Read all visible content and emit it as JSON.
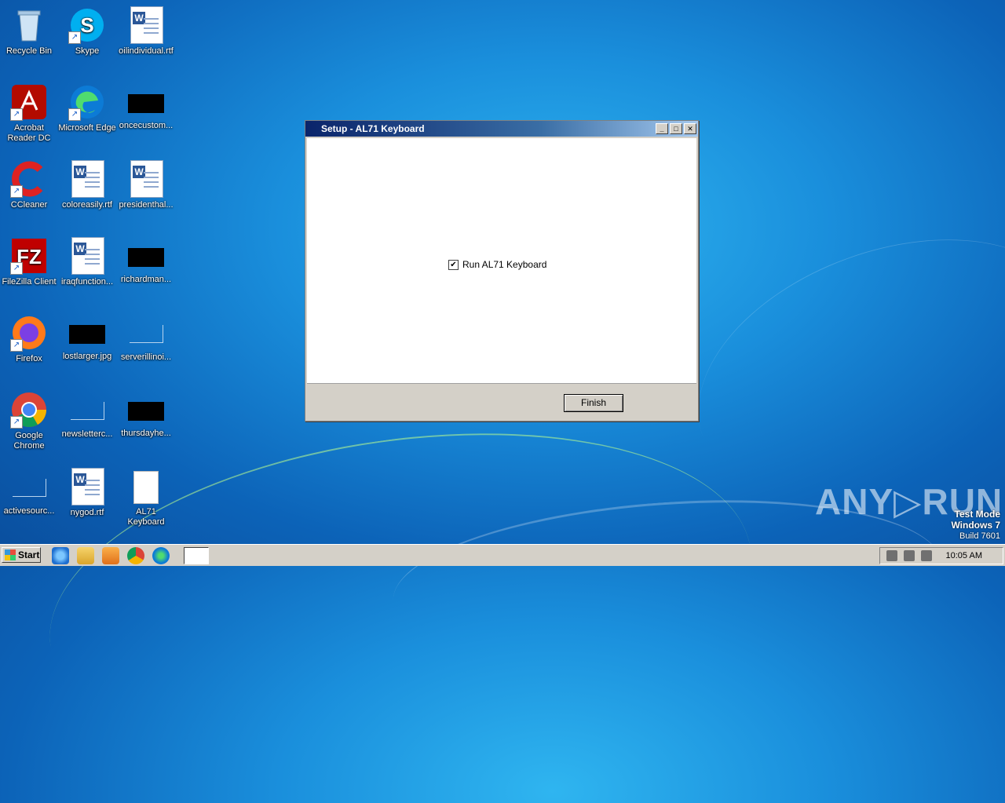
{
  "desktop_icons": [
    {
      "label": "Recycle Bin"
    },
    {
      "label": "Skype"
    },
    {
      "label": "oilindividual.rtf"
    },
    {
      "label": "Acrobat Reader DC"
    },
    {
      "label": "Microsoft Edge"
    },
    {
      "label": "oncecustom..."
    },
    {
      "label": "CCleaner"
    },
    {
      "label": "coloreasily.rtf"
    },
    {
      "label": "presidenthal..."
    },
    {
      "label": "FileZilla Client"
    },
    {
      "label": "iraqfunction..."
    },
    {
      "label": "richardman..."
    },
    {
      "label": "Firefox"
    },
    {
      "label": "lostlarger.jpg"
    },
    {
      "label": "serverillinoi..."
    },
    {
      "label": "Google Chrome"
    },
    {
      "label": "newsletterc..."
    },
    {
      "label": "thursdayhe..."
    },
    {
      "label": "activesourc..."
    },
    {
      "label": "nygod.rtf"
    },
    {
      "label": "AL71 Keyboard"
    }
  ],
  "setup_window": {
    "title": "Setup - AL71 Keyboard",
    "checkbox_label": "Run AL71 Keyboard",
    "checkbox_checked": true,
    "finish_label": "Finish"
  },
  "watermark": {
    "brand": "ANY▷RUN",
    "line1": "Test Mode",
    "line2": "Windows 7",
    "line3": "Build 7601"
  },
  "taskbar": {
    "start_label": "Start",
    "clock": "10:05 AM"
  }
}
